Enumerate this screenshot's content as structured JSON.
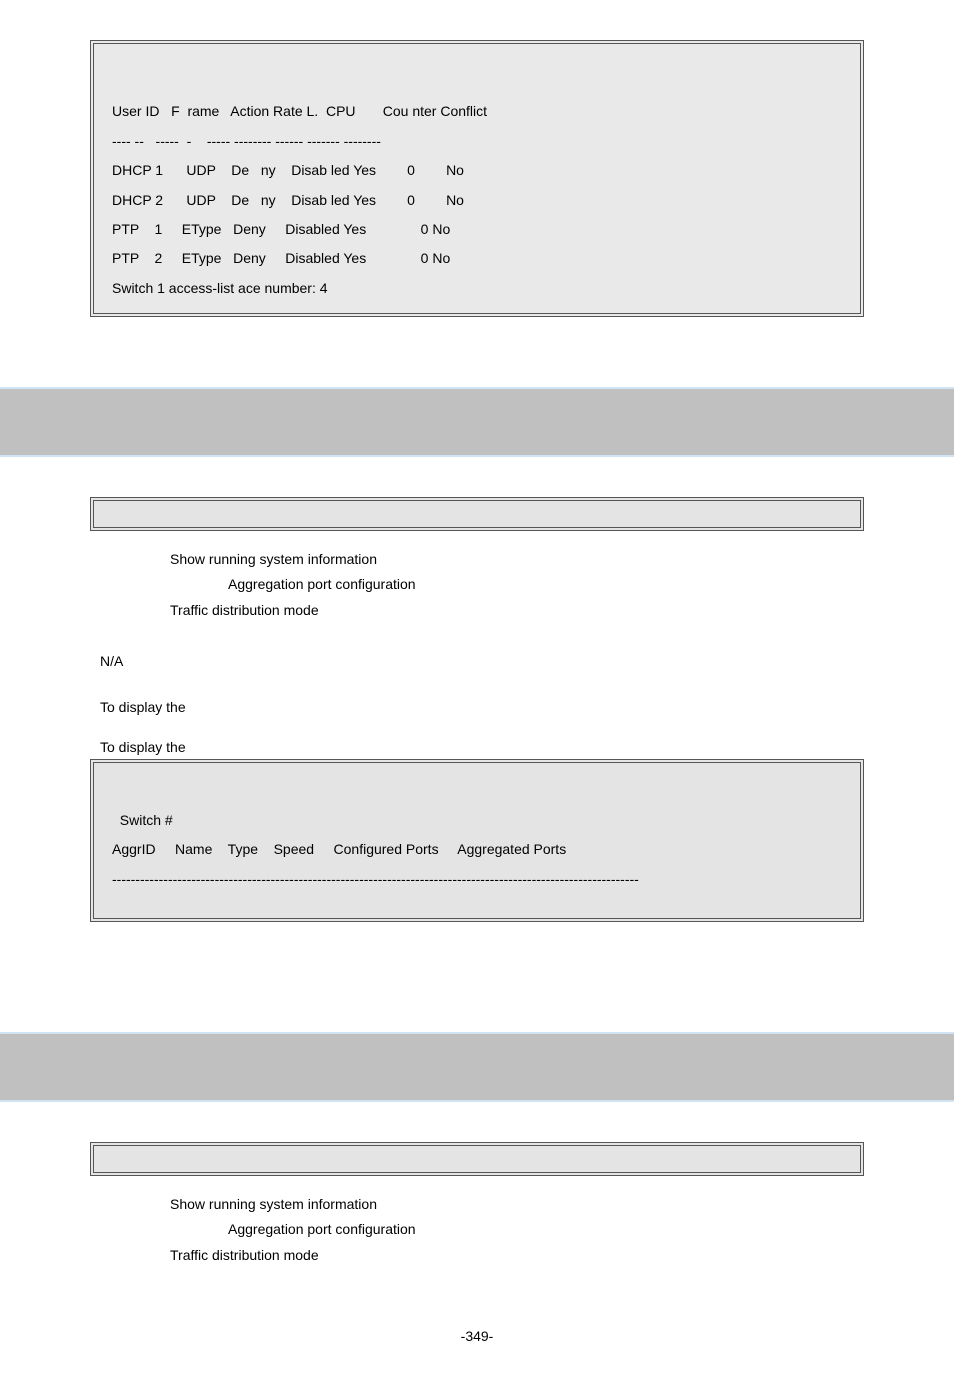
{
  "console1": {
    "header": "User ID   F  rame   Action Rate L.  CPU       Cou nter Conflict",
    "dashes": "---- --   -----  -    ----- -------- ------ ------- --------",
    "row1": "DHCP 1      UDP    De   ny    Disab led Yes        0        No",
    "row2": "DHCP 2      UDP    De   ny    Disab led Yes        0        No",
    "row3": "PTP    1     EType   Deny     Disabled Yes              0 No",
    "row4": "PTP    2     EType   Deny     Disabled Yes              0 No",
    "footer": "Switch 1 access-list ace number: 4"
  },
  "desc1": {
    "l1": "Show running system information",
    "l2": "Aggregation port configuration",
    "l3": "Traffic distribution mode"
  },
  "na": "N/A",
  "display1": "To display the",
  "display2": "To display the",
  "console2": {
    "row1": "Switch #",
    "row2": "AggrID     Name    Type    Speed     Configured Ports     Aggregated Ports",
    "row3": "-----------------------------------------------------------------------------------------------------------------"
  },
  "desc2": {
    "l1": "Show running system information",
    "l2": "Aggregation port configuration",
    "l3": "Traffic distribution mode"
  },
  "pageNum": "-349-"
}
